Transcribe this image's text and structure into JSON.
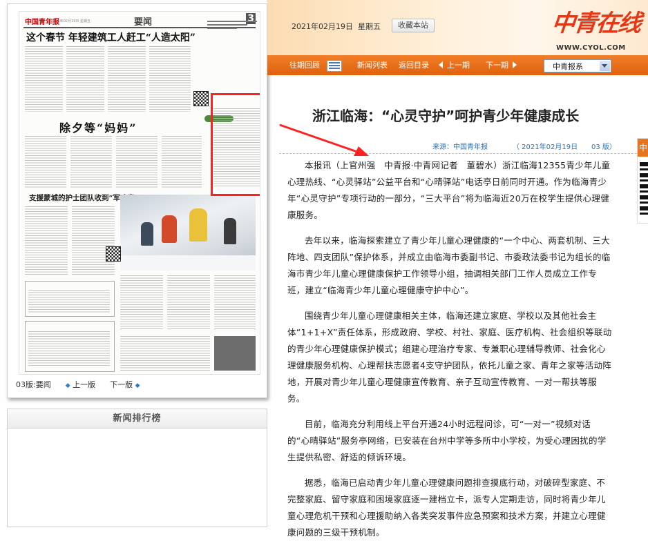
{
  "banner": {
    "date": "2021年02月19日",
    "weekday": "星期五",
    "favorite_label": "收藏本站",
    "logo_text": "中青在线",
    "site_url": "WWW.CYOL.COM"
  },
  "nav": {
    "history_label": "往期回顾",
    "news_list_label": "新闻列表",
    "back_to_toc_label": "返回目录",
    "prev_label": "上一期",
    "next_label": "下一期",
    "paper_select_value": "中青报系"
  },
  "paper": {
    "masthead_logo": "中国青年报",
    "section_name": "要闻",
    "page_no": "3",
    "headline_1": "这个春节 年轻建筑工人赶工“人造太阳”",
    "headline_2": "除夕等“妈妈”",
    "headline_3": "支援蒙城的护士团队收到“军功章”",
    "footer_page": "03版:要闻",
    "footer_prev": "上一版",
    "footer_next": "下一版"
  },
  "ranking": {
    "title": "新闻排行榜"
  },
  "article": {
    "title": "浙江临海：“心灵守护”呵护青少年健康成长",
    "source": "来源：中国青年报",
    "date": "（ 2021年02月19日",
    "page": "03 版）",
    "paragraphs": [
      "本报讯（上官州强　中青报·中青网记者　董碧水）浙江临海12355青少年儿童心理热线、“心灵驿站”公益平台和“心晴驿站”电话亭日前同时开通。作为临海青少年“心灵守护”专项行动的一部分，“三大平台”将为临海近20万在校学生提供心理健康服务。",
      "去年以来，临海探索建立了青少年儿童心理健康的“一个中心、两套机制、三大阵地、四支团队”保护体系，并成立由临海市委副书记、市委政法委书记为组长的临海市青少年儿童心理健康保护工作领导小组，抽调相关部门工作人员成立工作专班，建立“临海青少年儿童心理健康守护中心”。",
      "围绕青少年儿童心理健康相关主体，临海还建立家庭、学校以及其他社会主体“1+1+X”责任体系，形成政府、学校、村社、家庭、医疗机构、社会组织等联动的青少年心理健康保护模式；组建心理治疗专家、专兼职心理辅导教师、社会化心理健康服务机构、心理帮扶志愿者4支守护团队，依托儿童之家、青年之家等活动阵地，开展对青少年儿童心理健康宣传教育、亲子互动宣传教育、一对一帮扶等服务。",
      "目前，临海充分利用线上平台开通24小时远程问诊，可“一对一”视频对话的“心晴驿站”服务亭网络，已安装在台州中学等多所中小学校，为受心理困扰的学生提供私密、舒适的倾诉环境。",
      "据悉，临海已启动青少年儿童心理健康问题排查摸底行动，对破碎型家庭、不完整家庭、留守家庭和困境家庭逐一建档立卡，派专人定期走访，同时将青少年儿童心理危机干预和心理援助纳入各类突发事件应急预案和技术方案，并建立心理健康问题的三级干预机制。"
    ]
  },
  "float_tab": {
    "label": "中"
  },
  "colors": {
    "nav_orange": "#e8741e",
    "logo_red": "#e23a18",
    "highlight_red": "#ff2020",
    "link_blue": "#2c6fb5"
  },
  "icons": [
    "grid-icon",
    "arrow-left-icon",
    "arrow-right-icon",
    "chevron-down-icon",
    "diamond-icon",
    "qr-code-icon"
  ]
}
